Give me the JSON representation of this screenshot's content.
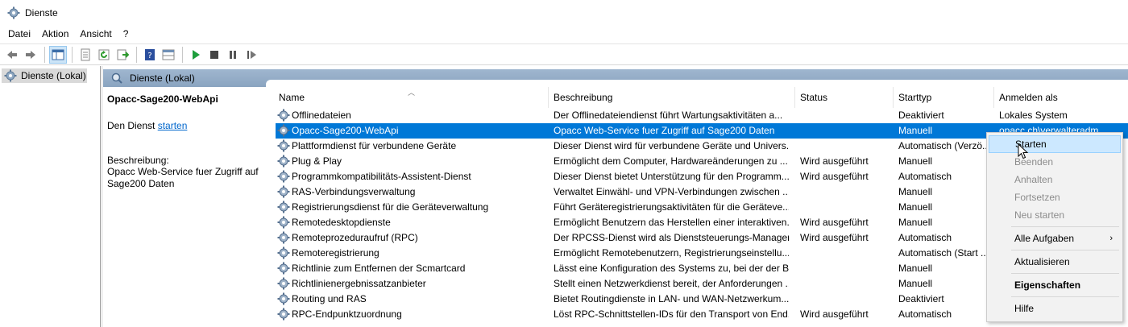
{
  "window": {
    "title": "Dienste",
    "icon": "gear-icon"
  },
  "menu": [
    "Datei",
    "Aktion",
    "Ansicht",
    "?"
  ],
  "toolbar": {
    "buttons": [
      "back-arrow-icon",
      "forward-arrow-icon",
      "console-tree-icon",
      "properties-icon",
      "refresh-icon",
      "export-icon",
      "help-icon",
      "extended-view-icon",
      "play-icon",
      "stop-icon",
      "pause-icon",
      "resume-icon"
    ]
  },
  "tree": {
    "label": "Dienste (Lokal)"
  },
  "panel": {
    "title": "Dienste (Lokal)"
  },
  "details": {
    "service_name": "Opacc-Sage200-WebApi",
    "start_prefix": "Den Dienst ",
    "start_link": "starten",
    "desc_label": "Beschreibung:",
    "desc_text": "Opacc Web-Service fuer Zugriff auf Sage200 Daten"
  },
  "columns": {
    "name": "Name",
    "description": "Beschreibung",
    "status": "Status",
    "start_type": "Starttyp",
    "logon": "Anmelden als"
  },
  "services": [
    {
      "name": "Offlinedateien",
      "description": "Der Offlinedateiendienst führt Wartungsaktivitäten a...",
      "status": "",
      "start_type": "Deaktiviert",
      "logon": "Lokales System"
    },
    {
      "name": "Opacc-Sage200-WebApi",
      "description": "Opacc Web-Service fuer Zugriff auf Sage200 Daten",
      "status": "",
      "start_type": "Manuell",
      "logon": "opacc.ch\\verwalteradm"
    },
    {
      "name": "Plattformdienst für verbundene Geräte",
      "description": "Dieser Dienst wird für verbundene Geräte und Univers...",
      "status": "",
      "start_type": "Automatisch (Verzö...",
      "logon": ""
    },
    {
      "name": "Plug & Play",
      "description": "Ermöglicht dem Computer, Hardwareänderungen zu ...",
      "status": "Wird ausgeführt",
      "start_type": "Manuell",
      "logon": ""
    },
    {
      "name": "Programmkompatibilitäts-Assistent-Dienst",
      "description": "Dieser Dienst bietet Unterstützung für den Programm...",
      "status": "Wird ausgeführt",
      "start_type": "Automatisch",
      "logon": ""
    },
    {
      "name": "RAS-Verbindungsverwaltung",
      "description": "Verwaltet Einwähl- und VPN-Verbindungen zwischen ...",
      "status": "",
      "start_type": "Manuell",
      "logon": ""
    },
    {
      "name": "Registrierungsdienst für die Geräteverwaltung",
      "description": "Führt Geräteregistrierungsaktivitäten für die Geräteve...",
      "status": "",
      "start_type": "Manuell",
      "logon": ""
    },
    {
      "name": "Remotedesktopdienste",
      "description": "Ermöglicht Benutzern das Herstellen einer interaktiven...",
      "status": "Wird ausgeführt",
      "start_type": "Manuell",
      "logon": ""
    },
    {
      "name": "Remoteprozeduraufruf (RPC)",
      "description": "Der RPCSS-Dienst wird als Dienststeuerungs-Manager ...",
      "status": "Wird ausgeführt",
      "start_type": "Automatisch",
      "logon": ""
    },
    {
      "name": "Remoteregistrierung",
      "description": "Ermöglicht Remotebenutzern, Registrierungseinstellu...",
      "status": "",
      "start_type": "Automatisch (Start ...",
      "logon": ""
    },
    {
      "name": "Richtlinie zum Entfernen der Scmartcard",
      "description": "Lässt eine Konfiguration des Systems zu, bei der der B...",
      "status": "",
      "start_type": "Manuell",
      "logon": ""
    },
    {
      "name": "Richtlinienergebnissatzanbieter",
      "description": "Stellt einen Netzwerkdienst bereit, der Anforderungen ...",
      "status": "",
      "start_type": "Manuell",
      "logon": ""
    },
    {
      "name": "Routing und RAS",
      "description": "Bietet Routingdienste in LAN- und WAN-Netzwerkum...",
      "status": "",
      "start_type": "Deaktiviert",
      "logon": ""
    },
    {
      "name": "RPC-Endpunktzuordnung",
      "description": "Löst RPC-Schnittstellen-IDs für den Transport von End...",
      "status": "Wird ausgeführt",
      "start_type": "Automatisch",
      "logon": ""
    }
  ],
  "context_menu": {
    "start": "Starten",
    "stop": "Beenden",
    "pause": "Anhalten",
    "resume": "Fortsetzen",
    "restart": "Neu starten",
    "all_tasks": "Alle Aufgaben",
    "refresh": "Aktualisieren",
    "properties": "Eigenschaften",
    "help": "Hilfe"
  },
  "colors": {
    "selection": "#0078d7",
    "panel_header": "#9fb6cf",
    "link": "#0066cc"
  }
}
